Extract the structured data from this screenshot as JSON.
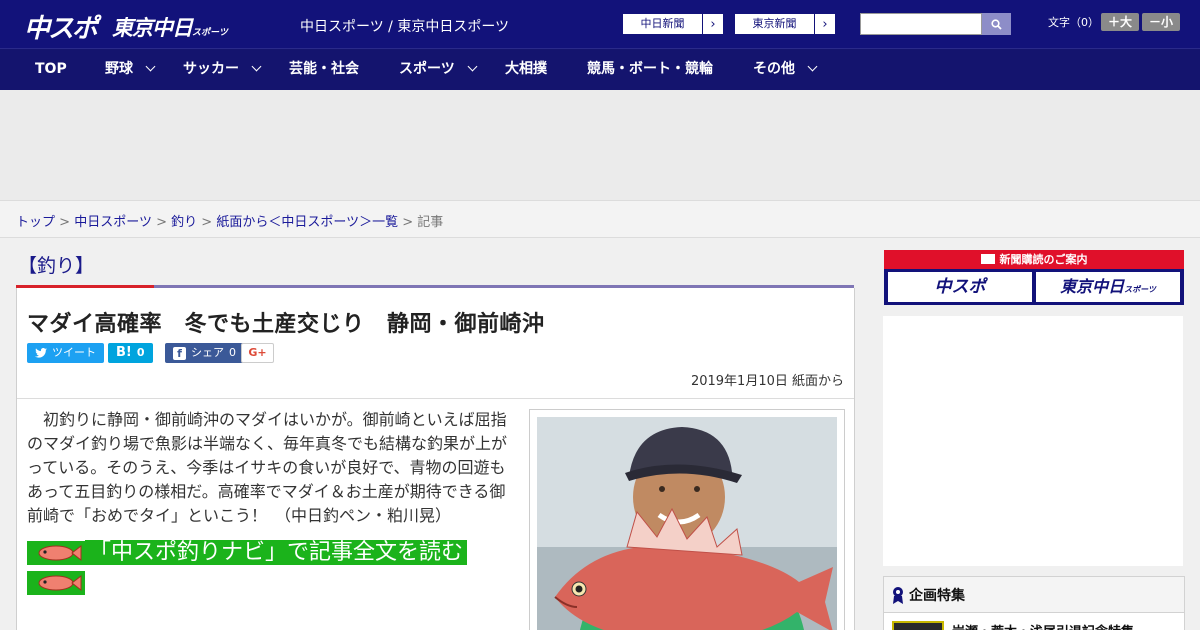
{
  "header": {
    "logo_main": "中スポ",
    "logo_sub": "東京中日",
    "logo_sub_small": "スポーツ",
    "site_links": "中日スポーツ / 東京中日スポーツ",
    "paper_buttons": [
      "中日新聞",
      "東京新聞"
    ],
    "paper_arrow": "›",
    "search_placeholder": "",
    "font_size_label": "文字（0）",
    "font_larger": "＋大",
    "font_smaller": "－小"
  },
  "nav": {
    "items": [
      "TOP",
      "野球",
      "サッカー",
      "芸能・社会",
      "スポーツ",
      "大相撲",
      "競馬・ボート・競輪",
      "その他"
    ]
  },
  "breadcrumb": {
    "items": [
      "トップ",
      "中日スポーツ",
      "釣り",
      "紙面から＜中日スポーツ＞一覧"
    ],
    "separator": ">",
    "current": "記事"
  },
  "article": {
    "category": "【釣り】",
    "headline": "マダイ高確率　冬でも土産交じり　静岡・御前崎沖",
    "share": {
      "tweet": "ツイート",
      "hatena_icon": "B!",
      "hatena_count": "0",
      "facebook_icon": "f",
      "facebook_label": "シェア",
      "facebook_count": "0",
      "gplus": "G+"
    },
    "date": "2019年1月10日 紙面から",
    "lead": "　初釣りに静岡・御前崎沖のマダイはいかが。御前崎といえば屈指のマダイ釣り場で魚影は半端なく、毎年真冬でも結構な釣果が上がっている。そのうえ、今季はイサキの食いが良好で、青物の回遊もあって五目釣りの様相だ。高確率でマダイ＆お土産が期待できる御前崎で「おめでタイ」といこう！　（中日釣ペン・粕川晃）",
    "navi_link": "「中スポ釣りナビ」で記事全文を読む"
  },
  "sidebar": {
    "subscribe_title": "新聞購読のご案内",
    "subscribe_buttons": [
      "中スポ",
      "東京中日"
    ],
    "subscribe_small": "スポーツ",
    "feature_title": "企画特集",
    "feature_item": "岩瀬・荒木・浅尾引退記念特集"
  },
  "colors": {
    "header_bg": "#12127a",
    "nav_bg": "#14146e",
    "accent_red": "#d8222a",
    "accent_purple": "#7f76b5",
    "navi_green": "#1bb31b",
    "twitter": "#1da1f2",
    "hatena": "#00a4de",
    "facebook": "#3b5998"
  }
}
